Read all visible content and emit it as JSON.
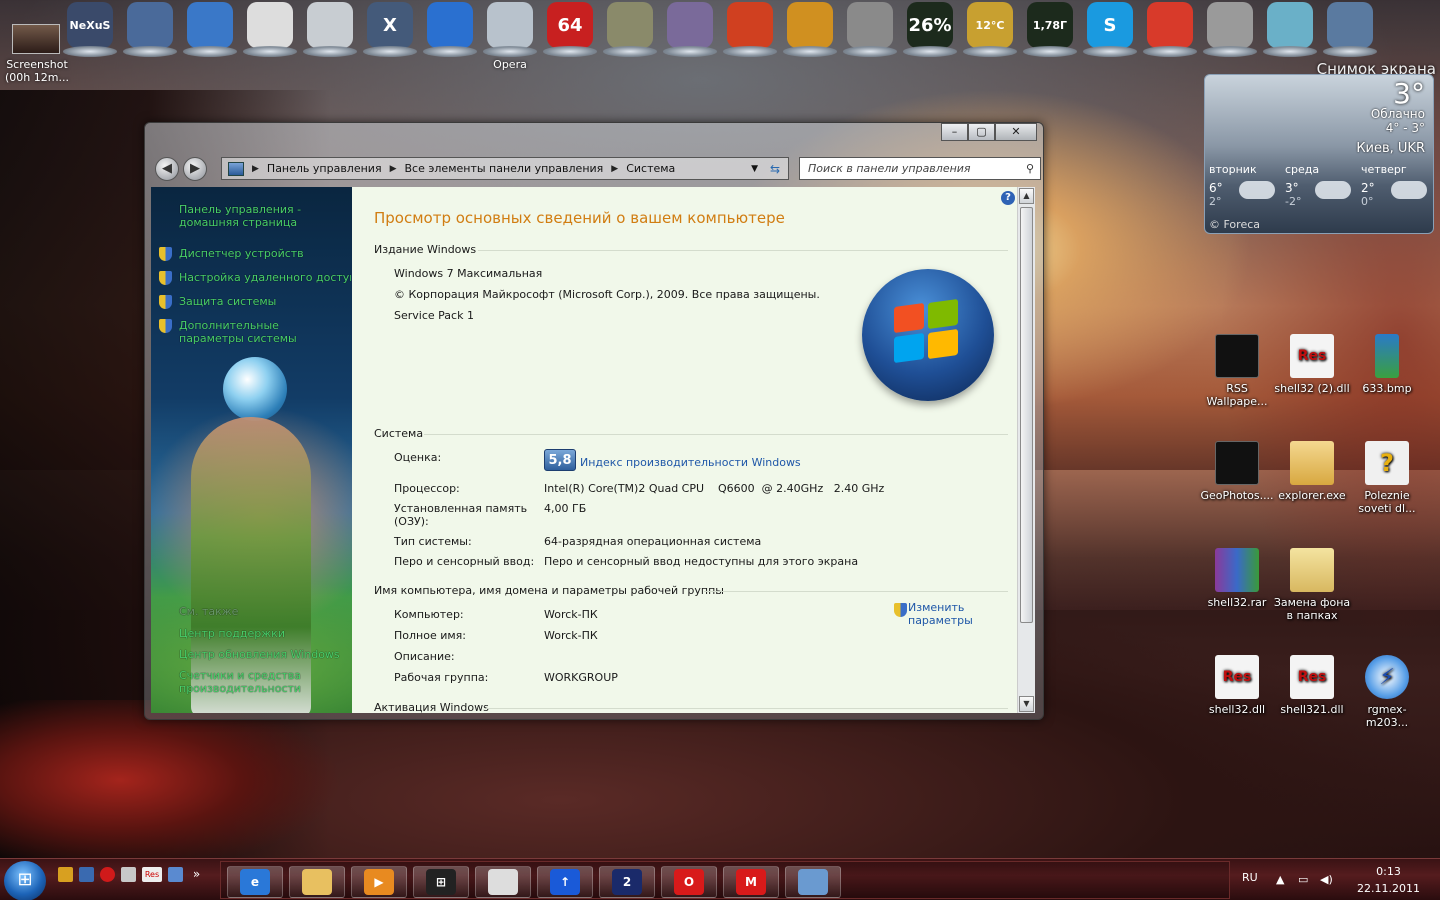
{
  "desktop": {
    "screenshot_item": {
      "label": "Screenshot (00h 12m..."
    },
    "dock": [
      {
        "name": "nexus",
        "text": "NeXuS",
        "color": "#3a4a6a"
      },
      {
        "name": "computer",
        "text": "",
        "color": "#4a6a9a"
      },
      {
        "name": "windows-flag",
        "text": "",
        "color": "#3a78c8"
      },
      {
        "name": "alien",
        "text": "",
        "color": "#dddddd"
      },
      {
        "name": "clock",
        "text": "",
        "color": "#c8cdd2"
      },
      {
        "name": "x-app",
        "text": "X",
        "color": "#445a7a"
      },
      {
        "name": "flash",
        "text": "",
        "color": "#2a70d0"
      },
      {
        "name": "recycle-bin",
        "text": "",
        "color": "#b8c2cc",
        "label": "Opera"
      },
      {
        "name": "win64",
        "text": "64",
        "color": "#c82020"
      },
      {
        "name": "printer-tray",
        "text": "",
        "color": "#8a8a6a"
      },
      {
        "name": "tools",
        "text": "",
        "color": "#7a6a9a"
      },
      {
        "name": "ccleaner",
        "text": "",
        "color": "#d04020"
      },
      {
        "name": "settings",
        "text": "",
        "color": "#d09020"
      },
      {
        "name": "film-reel",
        "text": "",
        "color": "#8a8a8a"
      },
      {
        "name": "cpu-meter",
        "text": "26%",
        "color": "#1c2a1c"
      },
      {
        "name": "weather-dock",
        "text": "12°C",
        "color": "#c8a030"
      },
      {
        "name": "ram-meter",
        "text": "1,78Г",
        "color": "#1c2a1c"
      },
      {
        "name": "skype",
        "text": "S",
        "color": "#1a9ae0"
      },
      {
        "name": "chrome",
        "text": "",
        "color": "#d83a2a"
      },
      {
        "name": "globe-trophy",
        "text": "",
        "color": "#9a9a9a"
      },
      {
        "name": "kaspersky",
        "text": "",
        "color": "#6ab0c8"
      },
      {
        "name": "image-viewer",
        "text": "",
        "color": "#5a7aa0"
      }
    ],
    "icons": [
      {
        "label": "RSS Wallpape...",
        "glyph": "",
        "color": "#222"
      },
      {
        "label": "shell32 (2).dll",
        "glyph": "Res",
        "color": "#f4f4f4"
      },
      {
        "label": "633.bmp",
        "glyph": "",
        "color": "#3a9a3a"
      },
      {
        "label": "GeoPhotos....",
        "glyph": "",
        "color": "#222"
      },
      {
        "label": "explorer.exe",
        "glyph": "",
        "color": "#e8c060"
      },
      {
        "label": "Poleznie soveti dl...",
        "glyph": "?",
        "color": "#f0f0f0"
      },
      {
        "label": "shell32.rar",
        "glyph": "",
        "color": "#7a3a8a"
      },
      {
        "label": "Замена фона в папках",
        "glyph": "",
        "color": "#e8c870"
      },
      {
        "label": "shell32.dll",
        "glyph": "Res",
        "color": "#f4f4f4"
      },
      {
        "label": "shell321.dll",
        "glyph": "Res",
        "color": "#f4f4f4"
      },
      {
        "label": "rgmex-m203...",
        "glyph": "⚡",
        "color": "#2a70d0"
      }
    ]
  },
  "weather": {
    "title": "Снимок экрана",
    "temp": "3°",
    "condition": "Облачно",
    "range": "4° - 3°",
    "city": "Киев, UKR",
    "days": [
      {
        "name": "вторник",
        "hi": "6°",
        "lo": "2°"
      },
      {
        "name": "среда",
        "hi": "3°",
        "lo": "-2°"
      },
      {
        "name": "четверг",
        "hi": "2°",
        "lo": "0°"
      }
    ],
    "source": "© Foreca"
  },
  "window": {
    "caption": {
      "minimize": "–",
      "maximize": "▢",
      "close": "✕"
    },
    "nav": {
      "back": "◀",
      "forward": "▶"
    },
    "breadcrumb": [
      "Панель управления",
      "Все элементы панели управления",
      "Система"
    ],
    "search_placeholder": "Поиск в панели управления",
    "left_links": [
      "Панель управления - домашняя страница",
      "Диспетчер устройств",
      "Настройка удаленного доступа",
      "Защита системы",
      "Дополнительные параметры системы"
    ],
    "see_also": {
      "heading": "См. также",
      "links": [
        "Центр поддержки",
        "Центр обновления Windows",
        "Счетчики и средства производительности"
      ]
    },
    "content": {
      "title": "Просмотр основных сведений о вашем компьютере",
      "edition_heading": "Издание Windows",
      "edition": "Windows 7 Максимальная",
      "copyright": "© Корпорация Майкрософт (Microsoft Corp.), 2009. Все права защищены.",
      "service_pack": "Service Pack 1",
      "system_heading": "Система",
      "rating_label": "Оценка:",
      "rating_value": "5,8",
      "rating_link": "Индекс производительности Windows",
      "cpu_label": "Процессор:",
      "cpu_value": "Intel(R) Core(TM)2 Quad CPU    Q6600  @ 2.40GHz   2.40 GHz",
      "ram_label": "Установленная память (ОЗУ):",
      "ram_value": "4,00 ГБ",
      "type_label": "Тип системы:",
      "type_value": "64-разрядная операционная система",
      "pen_label": "Перо и сенсорный ввод:",
      "pen_value": "Перо и сенсорный ввод недоступны для этого экрана",
      "name_heading": "Имя компьютера, имя домена и параметры рабочей группы",
      "computer_label": "Компьютер:",
      "computer_value": "Worck-ПК",
      "fullname_label": "Полное имя:",
      "fullname_value": "Worck-ПК",
      "desc_label": "Описание:",
      "desc_value": "",
      "workgroup_label": "Рабочая группа:",
      "workgroup_value": "WORKGROUP",
      "change_link": "Изменить параметры",
      "activation_heading": "Активация Windows"
    }
  },
  "taskbar": {
    "start": "⊞",
    "overflow": "»",
    "language": "RU",
    "time": "0:13",
    "date": "22.11.2011",
    "buttons": [
      {
        "name": "ie",
        "glyph": "e",
        "color": "#2a78d8"
      },
      {
        "name": "explorer",
        "glyph": "",
        "color": "#e8c060"
      },
      {
        "name": "media-player",
        "glyph": "▶",
        "color": "#e88a20"
      },
      {
        "name": "windows",
        "glyph": "⊞",
        "color": "#222"
      },
      {
        "name": "alien",
        "glyph": "",
        "color": "#ddd"
      },
      {
        "name": "upload",
        "glyph": "↑",
        "color": "#1a5ad8"
      },
      {
        "name": "total-commander",
        "glyph": "2",
        "color": "#1a2a6a"
      },
      {
        "name": "opera",
        "glyph": "O",
        "color": "#d81a1a"
      },
      {
        "name": "mvideo",
        "glyph": "M",
        "color": "#d81a1a"
      },
      {
        "name": "control-panel",
        "glyph": "",
        "color": "#6a9ad0"
      }
    ]
  }
}
